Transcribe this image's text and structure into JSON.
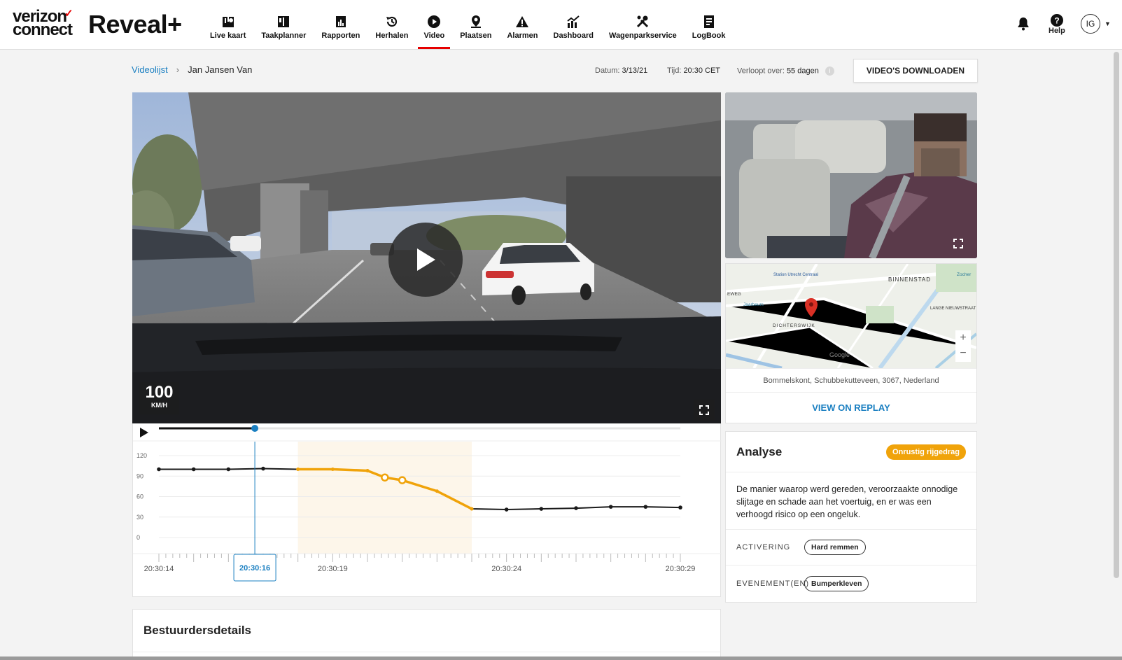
{
  "header": {
    "brand": "verizon",
    "brand2": "connect",
    "product": "Reveal+",
    "nav": [
      {
        "label": "Live kaart",
        "icon": "live-map-icon"
      },
      {
        "label": "Taakplanner",
        "icon": "task-planner-icon"
      },
      {
        "label": "Rapporten",
        "icon": "reports-icon"
      },
      {
        "label": "Herhalen",
        "icon": "replay-icon"
      },
      {
        "label": "Video",
        "icon": "video-icon",
        "active": true
      },
      {
        "label": "Plaatsen",
        "icon": "places-icon"
      },
      {
        "label": "Alarmen",
        "icon": "alerts-icon"
      },
      {
        "label": "Dashboard",
        "icon": "dashboard-icon"
      },
      {
        "label": "Wagenparkservice",
        "icon": "fleet-service-icon"
      },
      {
        "label": "LogBook",
        "icon": "logbook-icon"
      }
    ],
    "help_label": "Help",
    "avatar_initials": "IG",
    "accent": "#e60000"
  },
  "breadcrumb": {
    "root": "Videolijst",
    "current": "Jan Jansen Van"
  },
  "meta": {
    "date_label": "Datum:",
    "date_value": "3/13/21",
    "time_label": "Tijd:",
    "time_value": "20:30 CET",
    "expires_label": "Verloopt over:",
    "expires_value": "55 dagen",
    "info_glyph": "i"
  },
  "download_button": "VIDEO'S DOWNLOADEN",
  "video": {
    "speed_value": "100",
    "speed_unit": "KM/H",
    "progress": 0.184
  },
  "chart_data": {
    "type": "line",
    "y_ticks": [
      "120",
      "90",
      "60",
      "30",
      "0"
    ],
    "ylim": [
      0,
      120
    ],
    "x_labels": [
      "20:30:14",
      "20:30:19",
      "20:30:24",
      "20:30:29"
    ],
    "current_time": "20:30:16",
    "highlight_range": [
      18,
      23
    ],
    "series": [
      {
        "x": [
          14,
          15,
          16,
          17,
          18,
          19,
          20,
          20.5,
          21,
          22,
          23,
          24,
          25,
          26,
          27,
          28,
          29
        ],
        "values": [
          100,
          100,
          100,
          101,
          100,
          100,
          98,
          88,
          84,
          68,
          42,
          41,
          42,
          43,
          45,
          45,
          44
        ]
      }
    ],
    "line_color": "#1a1a1a",
    "highlight_color": "#f0a30a"
  },
  "map": {
    "address": "Bommelskont, Schubbekutteveen, 3067, Nederland",
    "replay_label": "VIEW ON REPLAY",
    "labels": [
      "BINNENSTAD",
      "DICHTERSWIJK",
      "LANGE NIEUWSTRAAT",
      "Jaarbeurs",
      "Station Utrecht Centraal",
      "Zocher",
      "EWEG",
      "Google"
    ]
  },
  "analyse": {
    "title": "Analyse",
    "badge": "Onrustig rijgedrag",
    "description": "De manier waarop werd gereden, veroorzaakte onnodige slijtage en schade aan het voertuig, en er was een verhoogd risico op een ongeluk.",
    "activation_label": "ACTIVERING",
    "activation_value": "Hard remmen",
    "events_label": "EVENEMENT(EN)",
    "events_value": "Bumperkleven"
  },
  "driver": {
    "title": "Bestuurdersdetails"
  }
}
